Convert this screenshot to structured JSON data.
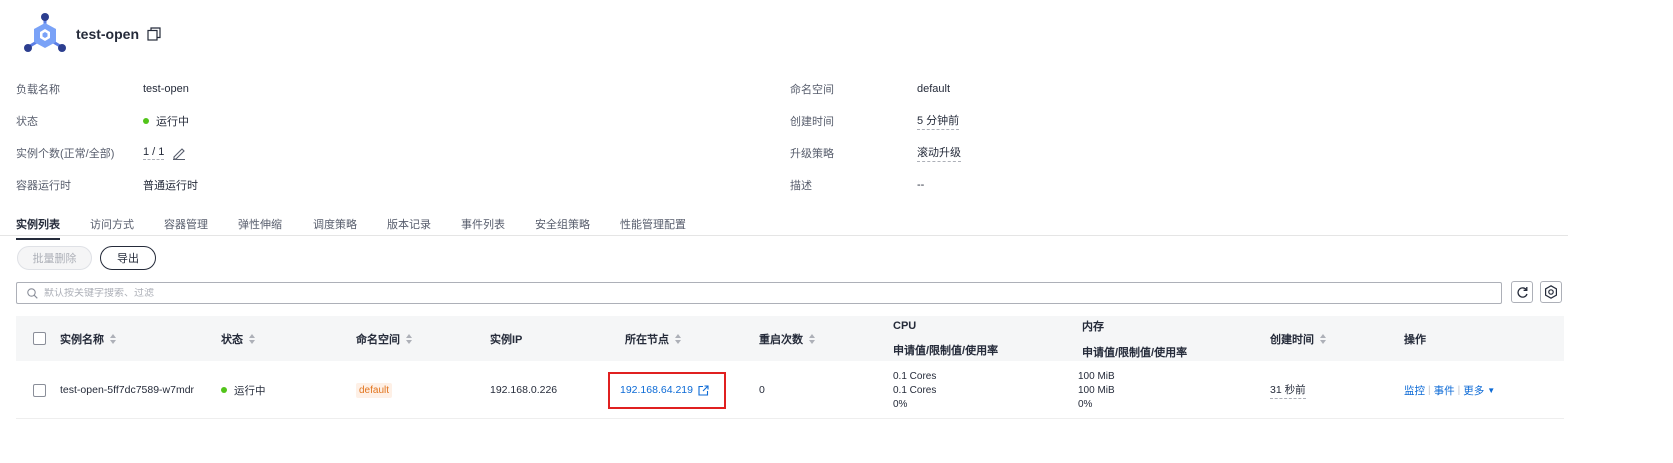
{
  "header": {
    "title": "test-open",
    "logo_icon": "workload-hexagon-icon",
    "copy_icon": "copy-icon"
  },
  "info": {
    "workload_name_label": "负载名称",
    "workload_name": "test-open",
    "status_label": "状态",
    "status": "运行中",
    "instances_label": "实例个数(正常/全部)",
    "instances": "1 / 1",
    "runtime_label": "容器运行时",
    "runtime": "普通运行时",
    "namespace_label": "命名空间",
    "namespace": "default",
    "created_label": "创建时间",
    "created": "5 分钟前",
    "upgrade_label": "升级策略",
    "upgrade": "滚动升级",
    "desc_label": "描述",
    "desc": "--"
  },
  "tabs": [
    "实例列表",
    "访问方式",
    "容器管理",
    "弹性伸缩",
    "调度策略",
    "版本记录",
    "事件列表",
    "安全组策略",
    "性能管理配置"
  ],
  "toolbar": {
    "batch_delete": "批量删除",
    "export": "导出"
  },
  "search": {
    "placeholder": "默认按关键字搜索、过滤"
  },
  "table": {
    "headers": {
      "name": "实例名称",
      "status": "状态",
      "namespace": "命名空间",
      "ip": "实例IP",
      "node": "所在节点",
      "restarts": "重启次数",
      "cpu": "CPU",
      "cpu_sub": "申请值/限制值/使用率",
      "mem": "内存",
      "mem_sub": "申请值/限制值/使用率",
      "created": "创建时间",
      "ops": "操作"
    },
    "rows": [
      {
        "name": "test-open-5ff7dc7589-w7mdr",
        "status": "运行中",
        "namespace": "default",
        "ip": "192.168.0.226",
        "node": "192.168.64.219",
        "restarts": "0",
        "cpu": [
          "0.1 Cores",
          "0.1 Cores",
          "0%"
        ],
        "mem": [
          "100 MiB",
          "100 MiB",
          "0%"
        ],
        "created": "31 秒前",
        "ops": {
          "monitor": "监控",
          "events": "事件",
          "more": "更多"
        }
      }
    ]
  },
  "colors": {
    "link": "#0c6ad6",
    "running": "#52c41a",
    "highlight": "#e02020",
    "ns_badge_text": "#e2751f"
  }
}
